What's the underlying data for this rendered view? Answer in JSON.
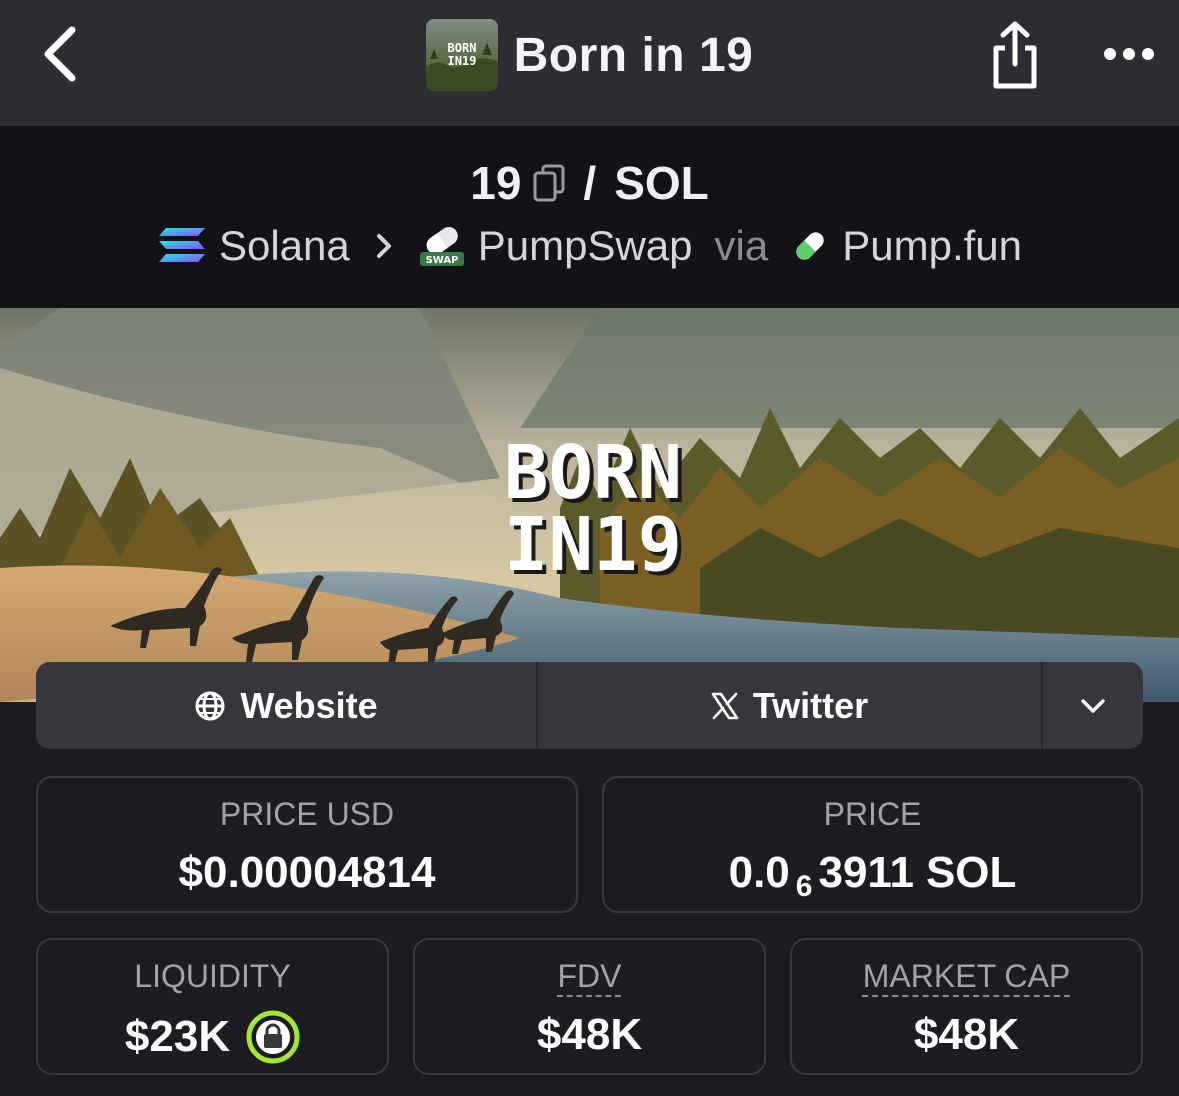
{
  "header": {
    "title": "Born in 19",
    "thumb_text_line1": "BORN",
    "thumb_text_line2": "IN19"
  },
  "pair": {
    "base": "19",
    "separator": "/",
    "quote": "SOL"
  },
  "chain": {
    "network": "Solana",
    "dex": "PumpSwap",
    "dex_badge": "SWAP",
    "via_label": "via",
    "launchpad": "Pump.fun"
  },
  "banner": {
    "line1": "BORN",
    "line2": "IN19"
  },
  "socials": {
    "website_label": "Website",
    "twitter_label": "Twitter"
  },
  "stats": {
    "price_usd": {
      "label": "PRICE USD",
      "value": "$0.00004814"
    },
    "price_native": {
      "label": "PRICE",
      "prefix": "0.0",
      "zeros_subscript": "6",
      "digits": "3911",
      "unit": "SOL"
    },
    "liquidity": {
      "label": "LIQUIDITY",
      "value": "$23K"
    },
    "fdv": {
      "label": "FDV",
      "value": "$48K"
    },
    "market_cap": {
      "label": "MARKET CAP",
      "value": "$48K"
    }
  },
  "colors": {
    "header_bg": "#2c2c31",
    "pair_bg": "#131317",
    "page_bg": "#1c1c21",
    "lock_green": "#a3e635"
  }
}
